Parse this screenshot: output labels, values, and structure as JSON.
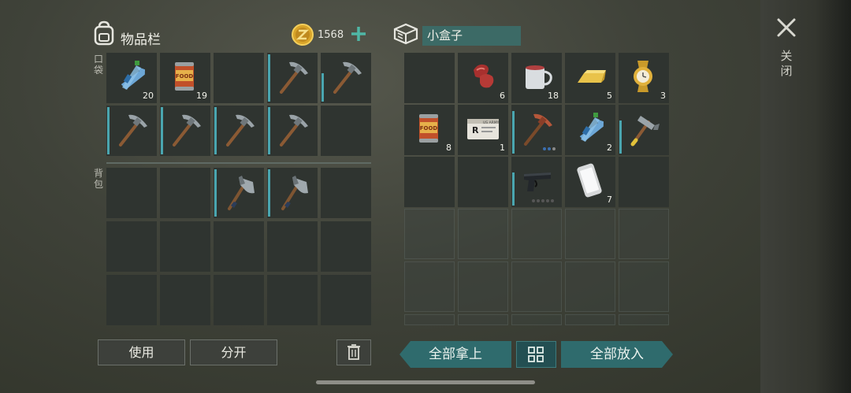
{
  "inventory": {
    "title": "物品栏",
    "coins": "1568",
    "pocket_label": "口袋",
    "backpack_label": "背包",
    "pocket_slots": [
      {
        "item": "water-bottle",
        "qty": "20",
        "dur": 0
      },
      {
        "item": "food-can",
        "qty": "19",
        "dur": 0
      },
      {
        "item": "",
        "qty": "",
        "dur": 0
      },
      {
        "item": "pickaxe",
        "qty": "",
        "dur": 1.0
      },
      {
        "item": "pickaxe",
        "qty": "",
        "dur": 0.6
      },
      {
        "item": "pickaxe",
        "qty": "",
        "dur": 1.0
      },
      {
        "item": "pickaxe",
        "qty": "",
        "dur": 1.0
      },
      {
        "item": "pickaxe",
        "qty": "",
        "dur": 1.0
      },
      {
        "item": "pickaxe",
        "qty": "",
        "dur": 1.0
      },
      {
        "item": "",
        "qty": "",
        "dur": 0
      }
    ],
    "backpack_slots": [
      {
        "item": "",
        "qty": "",
        "dur": 0
      },
      {
        "item": "",
        "qty": "",
        "dur": 0
      },
      {
        "item": "hatchet",
        "qty": "",
        "dur": 1.0
      },
      {
        "item": "hatchet",
        "qty": "",
        "dur": 1.0
      },
      {
        "item": "",
        "qty": "",
        "dur": 0
      },
      {
        "item": "",
        "qty": "",
        "dur": 0
      },
      {
        "item": "",
        "qty": "",
        "dur": 0
      },
      {
        "item": "",
        "qty": "",
        "dur": 0
      },
      {
        "item": "",
        "qty": "",
        "dur": 0
      },
      {
        "item": "",
        "qty": "",
        "dur": 0
      },
      {
        "item": "",
        "qty": "",
        "dur": 0
      },
      {
        "item": "",
        "qty": "",
        "dur": 0
      },
      {
        "item": "",
        "qty": "",
        "dur": 0
      },
      {
        "item": "",
        "qty": "",
        "dur": 0
      },
      {
        "item": "",
        "qty": "",
        "dur": 0
      }
    ],
    "use_label": "使用",
    "split_label": "分开"
  },
  "container": {
    "title": "小盒子",
    "slots": [
      {
        "item": "",
        "qty": "",
        "dur": 0
      },
      {
        "item": "raw-meat",
        "qty": "6",
        "dur": 0
      },
      {
        "item": "mug",
        "qty": "18",
        "dur": 0
      },
      {
        "item": "gold-bar",
        "qty": "5",
        "dur": 0
      },
      {
        "item": "gold-watch",
        "qty": "3",
        "dur": 0
      },
      {
        "item": "food-can",
        "qty": "8",
        "dur": 0
      },
      {
        "item": "army-id-card",
        "qty": "1",
        "dur": 0
      },
      {
        "item": "red-pickaxe",
        "qty": "",
        "dur": 0.9
      },
      {
        "item": "water-bottle",
        "qty": "2",
        "dur": 0
      },
      {
        "item": "hammer",
        "qty": "",
        "dur": 0.7
      },
      {
        "item": "",
        "qty": "",
        "dur": 0
      },
      {
        "item": "",
        "qty": "",
        "dur": 0
      },
      {
        "item": "pistol",
        "qty": "",
        "dur": 0.7
      },
      {
        "item": "smartphone",
        "qty": "7",
        "dur": 0
      },
      {
        "item": "",
        "qty": "",
        "dur": 0
      }
    ],
    "card_text": "US ARMY",
    "take_all_label": "全部拿上",
    "put_all_label": "全部放入"
  },
  "close_label": "关闭",
  "colors": {
    "accent": "#2f6b6d",
    "durability": "#4aa6b0",
    "title_bg": "#3c6a66"
  }
}
